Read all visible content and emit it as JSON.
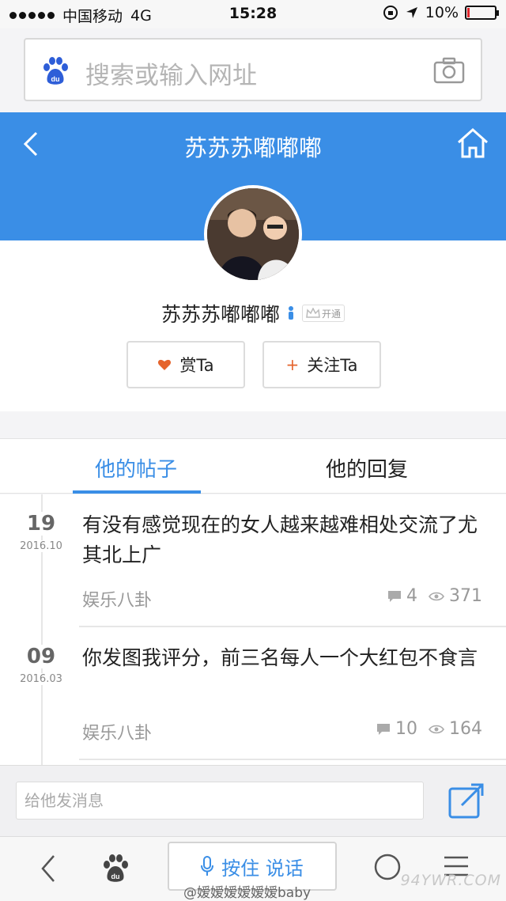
{
  "status_bar": {
    "carrier": "中国移动",
    "network": "4G",
    "time": "15:28",
    "battery": "10%",
    "battery_level": 0.1
  },
  "browser": {
    "search_placeholder": "搜索或输入网址"
  },
  "header": {
    "title": "苏苏苏嘟嘟嘟"
  },
  "profile": {
    "username": "苏苏苏嘟嘟嘟",
    "vip_label": "开通",
    "reward_button": "赏Ta",
    "follow_button": "关注Ta"
  },
  "tabs": [
    {
      "label": "他的帖子",
      "active": true
    },
    {
      "label": "他的回复",
      "active": false
    }
  ],
  "posts": [
    {
      "day": "19",
      "date": "2016.10",
      "title": "有没有感觉现在的女人越来越难相处交流了尤其北上广",
      "category": "娱乐八卦",
      "comments": "4",
      "views": "371"
    },
    {
      "day": "09",
      "date": "2016.03",
      "title": "你发图我评分，前三名每人一个大红包不食言",
      "category": "娱乐八卦",
      "comments": "10",
      "views": "164"
    }
  ],
  "message": {
    "placeholder": "给他发消息"
  },
  "toolbar": {
    "voice_label": "按住 说话"
  },
  "watermarks": {
    "user": "@嫒嫒嫒嫒嫒嫒baby",
    "site": "94YWR.COM"
  },
  "colors": {
    "accent": "#3a8ee6",
    "reward": "#e5642c"
  }
}
